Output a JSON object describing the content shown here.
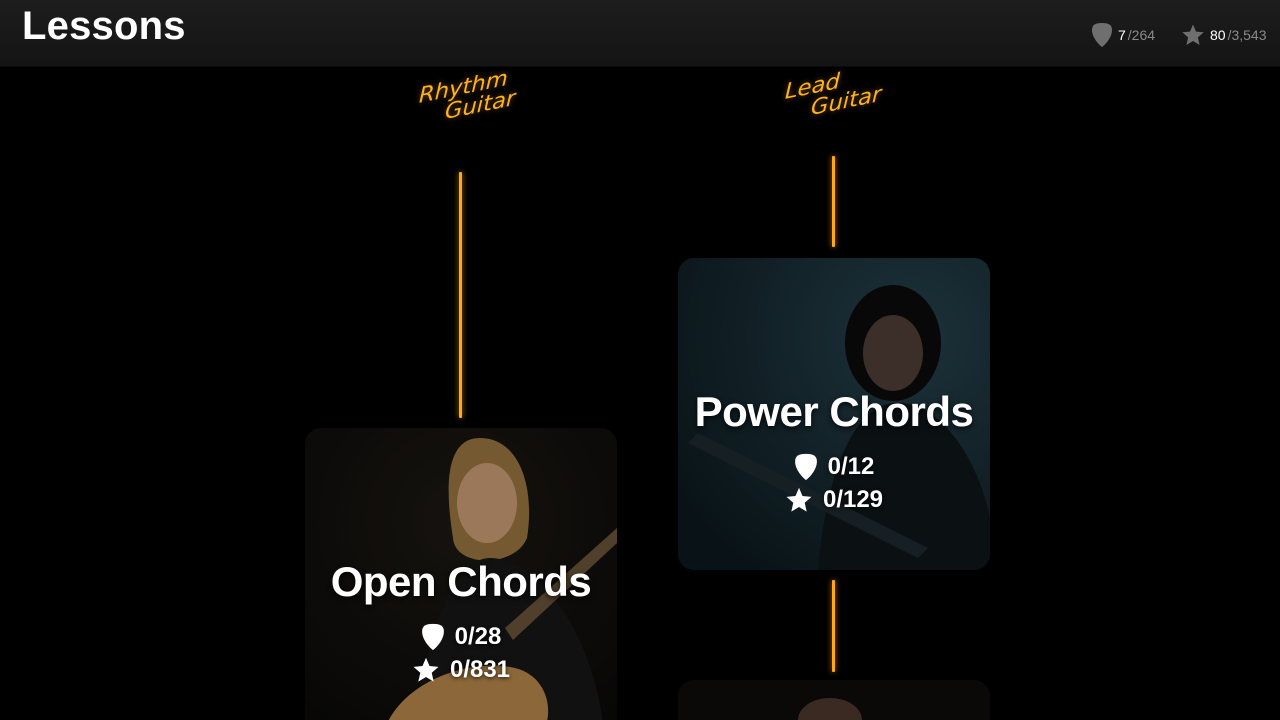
{
  "header": {
    "title": "Lessons",
    "picks": {
      "icon": "guitar-pick-icon",
      "earned": "7",
      "total": "/264"
    },
    "stars": {
      "icon": "star-icon",
      "earned": "80",
      "total": "/3,543"
    }
  },
  "tracks": [
    {
      "line1": "Rhythm",
      "line2": "Guitar",
      "logo": "rhythm-guitar-logo"
    },
    {
      "line1": "Lead",
      "line2": "Guitar",
      "logo": "lead-guitar-logo"
    }
  ],
  "lessons": [
    {
      "title": "Power Chords",
      "picks": "0/12",
      "stars": "0/129",
      "track": "Lead Guitar"
    },
    {
      "title": "Open Chords",
      "picks": "0/28",
      "stars": "0/831",
      "track": "Rhythm Guitar"
    }
  ],
  "colors": {
    "accent": "#ffa916",
    "background": "#000000",
    "topbar": "#181818",
    "muted_text": "#8a8a8a"
  }
}
